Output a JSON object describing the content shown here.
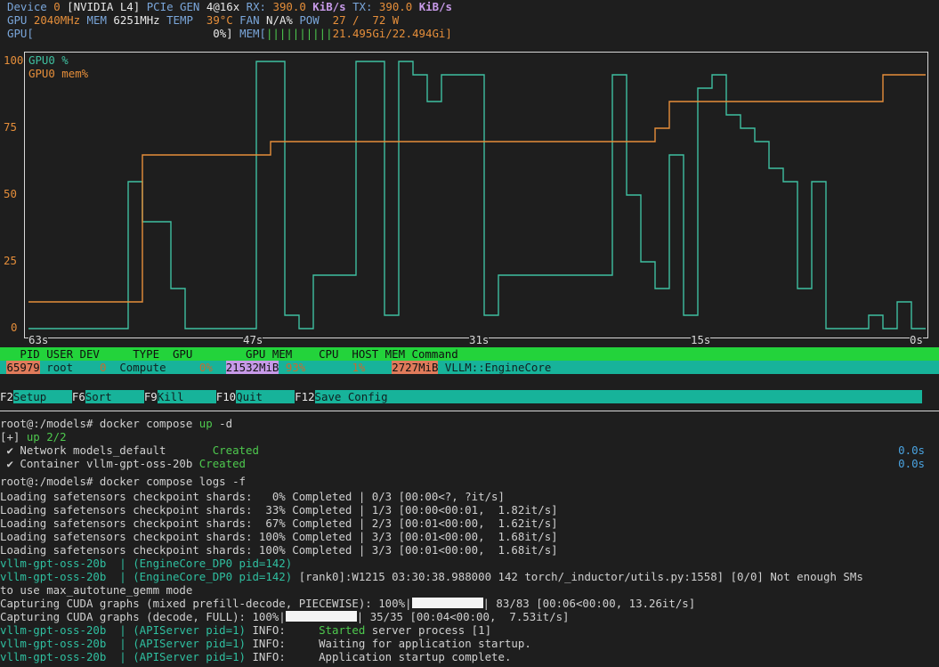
{
  "header": {
    "l1_device": "Device",
    "l1_dev_num": "0",
    "l1_gpu_name": "[NVIDIA L4]",
    "l1_pcie_label": "PCIe GEN",
    "l1_pcie_val": "4@16x",
    "l1_rx_label": "RX:",
    "l1_rx_val": "390.0",
    "l1_rx_unit": "KiB/s",
    "l1_tx_label": "TX:",
    "l1_tx_val": "390.0",
    "l1_tx_unit": "KiB/s",
    "l2_gpu_label": "GPU",
    "l2_gpu_clock": "2040MHz",
    "l2_mem_label": "MEM",
    "l2_mem_clock": "6251MHz",
    "l2_temp_label": "TEMP",
    "l2_temp_val": "39°C",
    "l2_fan_label": "FAN",
    "l2_fan_val": "N/A%",
    "l2_pow_label": "POW",
    "l2_pow_val": "27 /  72 W",
    "l3_gpu_label": "GPU[",
    "l3_gpu_pct": "0%]",
    "l3_mem_label": "MEM[",
    "l3_mem_bar": "||||||||||",
    "l3_mem_val": "21.495Gi/22.494Gi]"
  },
  "chart": {
    "y_ticks": [
      "100",
      "75",
      "50",
      "25",
      "0"
    ],
    "x_ticks": [
      "63s",
      "47s",
      "31s",
      "15s",
      "0s"
    ],
    "legend_gpu": "GPU0 %",
    "legend_mem": "GPU0 mem%",
    "colors": {
      "gpu": "#3fbfa0",
      "mem": "#e58e3a",
      "frame": "#d8d8d8"
    }
  },
  "chart_data": {
    "type": "line",
    "xlabel": "",
    "ylabel": "",
    "ylim": [
      0,
      100
    ],
    "xlim": [
      -63,
      0
    ],
    "series": [
      {
        "name": "GPU0 %",
        "x": [
          -63,
          -62,
          -61,
          -60,
          -59,
          -58,
          -57,
          -56,
          -55,
          -54,
          -53,
          -52,
          -51,
          -50,
          -49,
          -48,
          -47,
          -46,
          -45,
          -44,
          -43,
          -42,
          -41,
          -40,
          -39,
          -38,
          -37,
          -36,
          -35,
          -34,
          -33,
          -32,
          -31,
          -30,
          -29,
          -28,
          -27,
          -26,
          -25,
          -24,
          -23,
          -22,
          -21,
          -20,
          -19,
          -18,
          -17,
          -16,
          -15,
          -14,
          -13,
          -12,
          -11,
          -10,
          -9,
          -8,
          -7,
          -6,
          -5,
          -4,
          -3,
          -2,
          -1,
          0
        ],
        "y": [
          0,
          0,
          0,
          0,
          0,
          0,
          0,
          55,
          40,
          40,
          15,
          0,
          0,
          0,
          0,
          0,
          100,
          100,
          5,
          0,
          20,
          20,
          20,
          100,
          100,
          5,
          100,
          95,
          85,
          95,
          95,
          95,
          5,
          20,
          20,
          20,
          20,
          20,
          20,
          20,
          20,
          95,
          50,
          25,
          15,
          65,
          5,
          90,
          95,
          80,
          75,
          70,
          60,
          55,
          15,
          55,
          0,
          0,
          0,
          5,
          0,
          10,
          0,
          0
        ]
      },
      {
        "name": "GPU0 mem%",
        "x": [
          -63,
          -56,
          -55,
          -52,
          -51,
          -47,
          -46,
          -45,
          -44,
          -43,
          -42,
          -40,
          -35,
          -30,
          -25,
          -20,
          -19,
          -18,
          -17,
          -16,
          -15,
          -14,
          -13,
          -12,
          -8,
          -7,
          -6,
          -5,
          -4,
          -3,
          -2,
          -1,
          0
        ],
        "y": [
          10,
          10,
          65,
          65,
          65,
          65,
          70,
          70,
          70,
          70,
          70,
          70,
          70,
          70,
          70,
          70,
          75,
          85,
          85,
          85,
          85,
          85,
          85,
          85,
          85,
          85,
          85,
          85,
          85,
          95,
          95,
          95,
          95
        ]
      }
    ]
  },
  "proc": {
    "header": "   PID USER DEV     TYPE  GPU        GPU MEM    CPU  HOST MEM Command",
    "pid": "65979",
    "user": "root",
    "dev": "0",
    "type": "Compute",
    "gpu": "0%",
    "gpumem": "21532MiB",
    "gpumem_pct": "93%",
    "cpu": "1%",
    "hostmem": "2727MiB",
    "command": "VLLM::EngineCore"
  },
  "fkeys": [
    {
      "key": "F2",
      "label": "Setup"
    },
    {
      "key": "F6",
      "label": "Sort"
    },
    {
      "key": "F9",
      "label": "Kill"
    },
    {
      "key": "F10",
      "label": "Quit"
    },
    {
      "key": "F12",
      "label": "Save Config"
    }
  ],
  "terminal": {
    "prompt1": "root@:/models# docker compose ",
    "cmd1_up": "up",
    "cmd1_rest": " -d",
    "up_prefix": "[+] ",
    "up_status": "up 2/2",
    "net_line": " ✔ Network models_default       ",
    "net_status": "Created",
    "net_time": "0.0s",
    "cont_line": " ✔ Container vllm-gpt-oss-20b ",
    "cont_status": "Created",
    "cont_time": "0.0s",
    "prompt2": "root@:/models# docker compose logs -f",
    "shards": [
      "Loading safetensors checkpoint shards:   0% Completed | 0/3 [00:00<?, ?it/s]",
      "Loading safetensors checkpoint shards:  33% Completed | 1/3 [00:00<00:01,  1.82it/s]",
      "Loading safetensors checkpoint shards:  67% Completed | 2/3 [00:01<00:00,  1.62it/s]",
      "Loading safetensors checkpoint shards: 100% Completed | 3/3 [00:01<00:00,  1.68it/s]",
      "Loading safetensors checkpoint shards: 100% Completed | 3/3 [00:01<00:00,  1.68it/s]"
    ],
    "svc_engine": "vllm-gpt-oss-20b  | (EngineCore_DP0 pid=142)",
    "svc_engine2": "vllm-gpt-oss-20b  | (EngineCore_DP0 pid=142)",
    "warn_rest": " [rank0]:W1215 03:30:38.988000 142 torch/_inductor/utils.py:1558] [0/0] Not enough SMs",
    "warn_cont": "to use max_autotune_gemm mode",
    "cuda1_a": "Capturing CUDA graphs (mixed prefill-decode, PIECEWISE): 100%|",
    "cuda1_b": "| 83/83 [00:06<00:00, 13.26it/s]",
    "cuda2_a": "Capturing CUDA graphs (decode, FULL): 100%|",
    "cuda2_b": "| 35/35 [00:04<00:00,  7.53it/s]",
    "api_svc": "vllm-gpt-oss-20b  | (APIServer pid=1)",
    "api1_info": " INFO:     ",
    "api1_msg_a": "Started",
    "api1_msg_b": " server process [1]",
    "api2_msg": " INFO:     Waiting for application startup.",
    "api3_msg": " INFO:     Application startup complete."
  }
}
